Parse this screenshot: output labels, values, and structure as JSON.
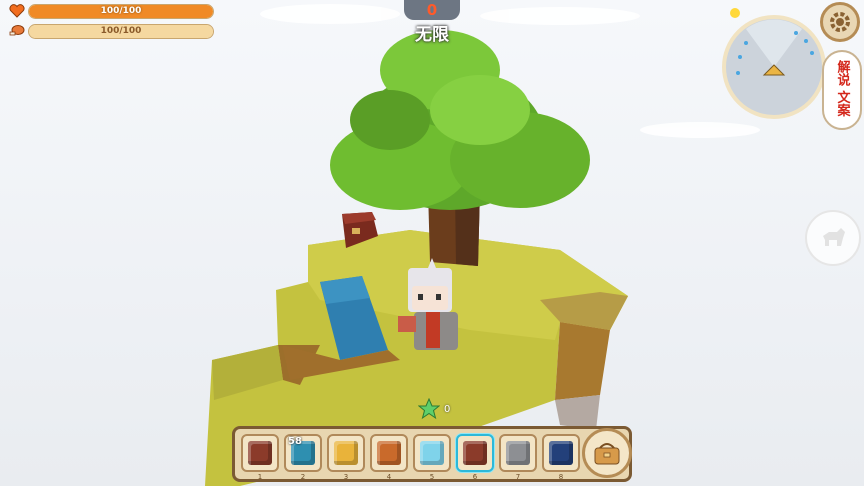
{
  "hud": {
    "health": {
      "text": "100/100",
      "level": 1.0,
      "color": "#f08a26",
      "icon": "heart-icon"
    },
    "hunger": {
      "text": "100/100",
      "level": 1.0,
      "color": "#f5d8a0",
      "icon": "drumstick-icon"
    },
    "counter": "0",
    "mode_label": "无限",
    "stars": {
      "count": "0",
      "icon": "star-icon"
    }
  },
  "minimap": {
    "icon": "compass-arrow-icon"
  },
  "buttons": {
    "settings": {
      "icon": "gear-icon"
    },
    "side_tag_text": "解说 文案",
    "pet": {
      "icon": "pet-icon"
    },
    "backpack": {
      "icon": "backpack-icon"
    }
  },
  "hotbar": {
    "slots": [
      {
        "num": "1",
        "item": "crate-icon",
        "count": "",
        "color": "#8b3b2a",
        "selected": false
      },
      {
        "num": "2",
        "item": "crystal-block-icon",
        "count": "58",
        "color": "#2e8fb0",
        "selected": false
      },
      {
        "num": "3",
        "item": "gold-box-icon",
        "count": "",
        "color": "#e9b33a",
        "selected": false
      },
      {
        "num": "4",
        "item": "bucket-icon",
        "count": "",
        "color": "#c96a2b",
        "selected": false
      },
      {
        "num": "5",
        "item": "ice-block-icon",
        "count": "",
        "color": "#7fd3ea",
        "selected": false
      },
      {
        "num": "6",
        "item": "crate-icon",
        "count": "",
        "color": "#8b3b2a",
        "selected": true
      },
      {
        "num": "7",
        "item": "stone-block-icon",
        "count": "",
        "color": "#8d8f93",
        "selected": false
      },
      {
        "num": "8",
        "item": "sapphire-block-icon",
        "count": "",
        "color": "#23407a",
        "selected": false
      }
    ]
  }
}
